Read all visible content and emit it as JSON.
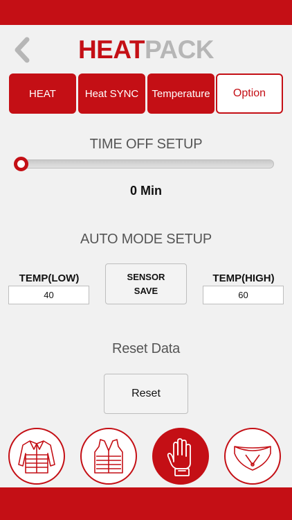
{
  "header": {
    "title_part1": "HEAT",
    "title_part2": "PACK"
  },
  "tabs": [
    {
      "label": "HEAT",
      "active": false
    },
    {
      "label": "Heat SYNC",
      "active": false
    },
    {
      "label": "Temperature",
      "active": false
    },
    {
      "label": "Option",
      "active": true
    }
  ],
  "time_off": {
    "title": "TIME OFF SETUP",
    "value_label": "0 Min",
    "level": 0
  },
  "auto_mode": {
    "title": "AUTO MODE SETUP",
    "temp_low_label": "TEMP(LOW)",
    "temp_low_value": "40",
    "sensor_save_line1": "SENSOR",
    "sensor_save_line2": "SAVE",
    "temp_high_label": "TEMP(HIGH)",
    "temp_high_value": "60"
  },
  "reset": {
    "title": "Reset Data",
    "button_label": "Reset"
  },
  "devices": [
    {
      "icon": "jacket-icon",
      "active": false
    },
    {
      "icon": "vest-icon",
      "active": false
    },
    {
      "icon": "glove-icon",
      "active": true
    },
    {
      "icon": "neck-warmer-icon",
      "active": false
    }
  ],
  "colors": {
    "accent": "#c40f15",
    "background": "#f1f1f1",
    "title_gray": "#b6b6b6"
  }
}
